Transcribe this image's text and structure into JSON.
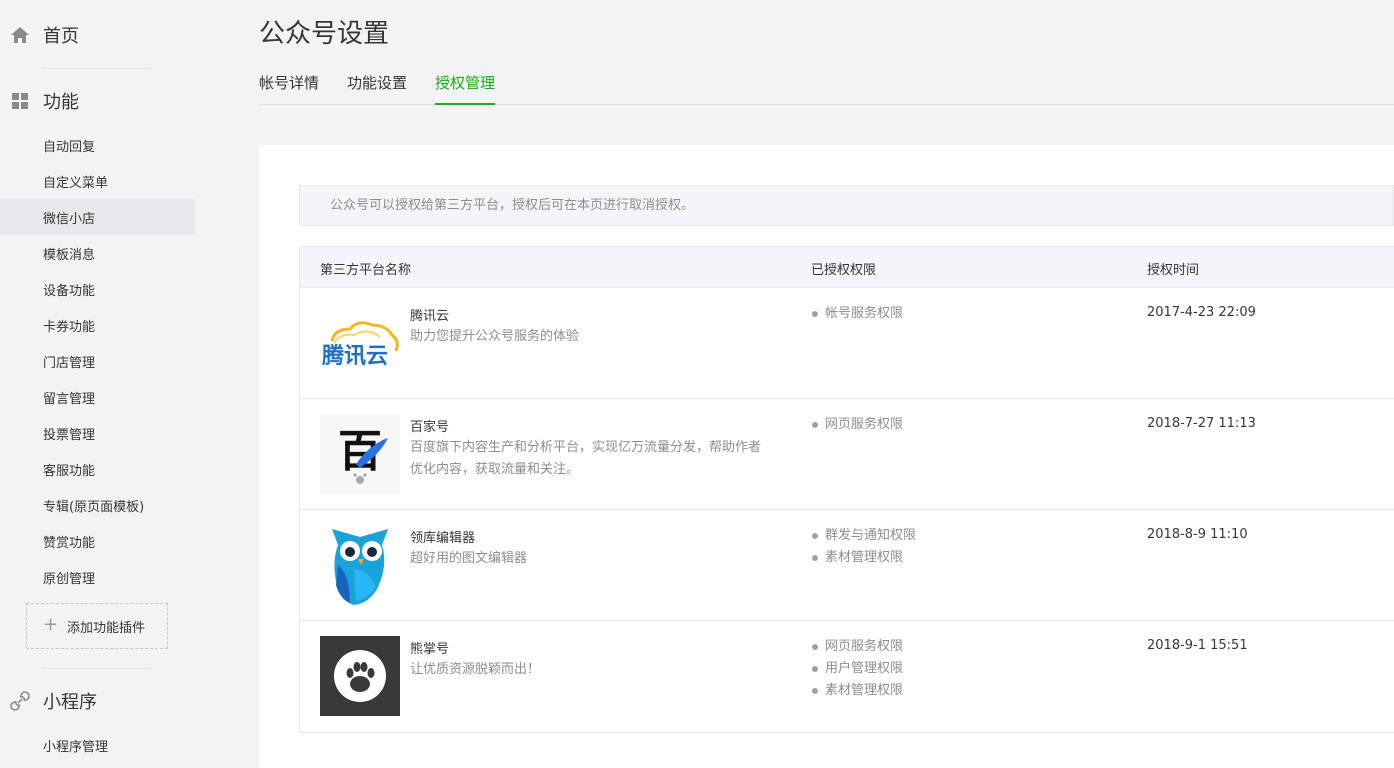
{
  "sidebar": {
    "home": {
      "label": "首页",
      "icon": "home-icon"
    },
    "features": {
      "label": "功能",
      "icon": "grid-icon",
      "items": [
        {
          "label": "自动回复"
        },
        {
          "label": "自定义菜单"
        },
        {
          "label": "微信小店",
          "active": true
        },
        {
          "label": "模板消息"
        },
        {
          "label": "设备功能"
        },
        {
          "label": "卡券功能"
        },
        {
          "label": "门店管理"
        },
        {
          "label": "留言管理"
        },
        {
          "label": "投票管理"
        },
        {
          "label": "客服功能"
        },
        {
          "label": "专辑(原页面模板)"
        },
        {
          "label": "赞赏功能"
        },
        {
          "label": "原创管理"
        }
      ],
      "add_plugin": "添加功能插件"
    },
    "miniprogram": {
      "label": "小程序",
      "icon": "link-icon",
      "items": [
        {
          "label": "小程序管理"
        }
      ]
    }
  },
  "main": {
    "title": "公众号设置",
    "tabs": [
      {
        "label": "帐号详情"
      },
      {
        "label": "功能设置"
      },
      {
        "label": "授权管理",
        "active": true
      }
    ],
    "notice": "公众号可以授权给第三方平台，授权后可在本页进行取消授权。",
    "table": {
      "headers": [
        "第三方平台名称",
        "已授权权限",
        "授权时间"
      ],
      "rows": [
        {
          "name": "腾讯云",
          "desc": "助力您提升公众号服务的体验",
          "logo_text": "腾讯云",
          "permissions": [
            "帐号服务权限"
          ],
          "time": "2017-4-23 22:09"
        },
        {
          "name": "百家号",
          "desc": "百度旗下内容生产和分析平台，实现亿万流量分发，帮助作者优化内容，获取流量和关注。",
          "logo_text": "百",
          "permissions": [
            "网页服务权限"
          ],
          "time": "2018-7-27 11:13"
        },
        {
          "name": "领库编辑器",
          "desc": "超好用的图文编辑器",
          "permissions": [
            "群发与通知权限",
            "素材管理权限"
          ],
          "time": "2018-8-9 11:10"
        },
        {
          "name": "熊掌号",
          "desc": "让优质资源脱颖而出！",
          "permissions": [
            "网页服务权限",
            "用户管理权限",
            "素材管理权限"
          ],
          "time": "2018-9-1 15:51"
        }
      ]
    }
  },
  "colors": {
    "accent": "#1aad19",
    "muted": "#8d8d8d",
    "text": "#353535"
  }
}
